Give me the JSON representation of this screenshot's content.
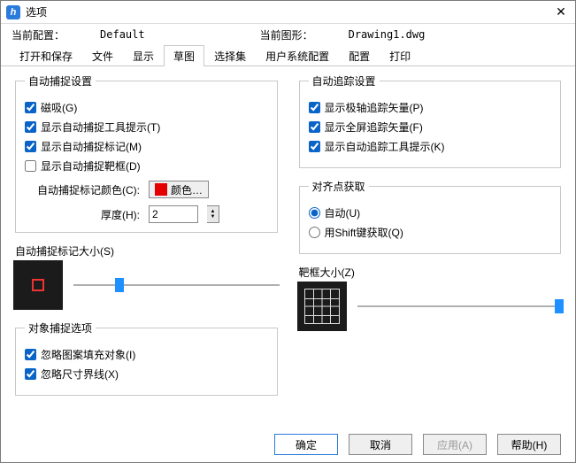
{
  "window": {
    "title": "选项"
  },
  "info": {
    "profile_label": "当前配置：",
    "profile_value": "Default",
    "drawing_label": "当前图形：",
    "drawing_value": "Drawing1.dwg"
  },
  "tabs": {
    "items": [
      {
        "label": "打开和保存"
      },
      {
        "label": "文件"
      },
      {
        "label": "显示"
      },
      {
        "label": "草图"
      },
      {
        "label": "选择集"
      },
      {
        "label": "用户系统配置"
      },
      {
        "label": "配置"
      },
      {
        "label": "打印"
      }
    ],
    "active_index": 3
  },
  "autosnap": {
    "legend": "自动捕捉设置",
    "magnet": "磁吸(G)",
    "tooltip": "显示自动捕捉工具提示(T)",
    "marker": "显示自动捕捉标记(M)",
    "aperture": "显示自动捕捉靶框(D)",
    "magnet_checked": true,
    "tooltip_checked": true,
    "marker_checked": true,
    "aperture_checked": false,
    "color_label": "自动捕捉标记颜色(C):",
    "color_btn": "颜色…",
    "color_hex": "#e40000",
    "thickness_label": "厚度(H):",
    "thickness_value": "2"
  },
  "marker_size": {
    "label": "自动捕捉标记大小(S)",
    "thumb_pos_pct": 20
  },
  "object_snap": {
    "legend": "对象捕捉选项",
    "ignore_hatch": "忽略图案填充对象(I)",
    "ignore_ext": "忽略尺寸界线(X)",
    "ignore_hatch_checked": true,
    "ignore_ext_checked": true
  },
  "autotrack": {
    "legend": "自动追踪设置",
    "polar_vec": "显示极轴追踪矢量(P)",
    "fullscreen_vec": "显示全屏追踪矢量(F)",
    "track_tooltip": "显示自动追踪工具提示(K)",
    "polar_vec_checked": true,
    "fullscreen_vec_checked": true,
    "track_tooltip_checked": true
  },
  "align_acquire": {
    "legend": "对齐点获取",
    "auto": "自动(U)",
    "shift": "用Shift键获取(Q)",
    "selected": "auto"
  },
  "aperture_size": {
    "label": "靶框大小(Z)",
    "thumb_pos_pct": 96
  },
  "buttons": {
    "ok": "确定",
    "cancel": "取消",
    "apply": "应用(A)",
    "help": "帮助(H)"
  }
}
